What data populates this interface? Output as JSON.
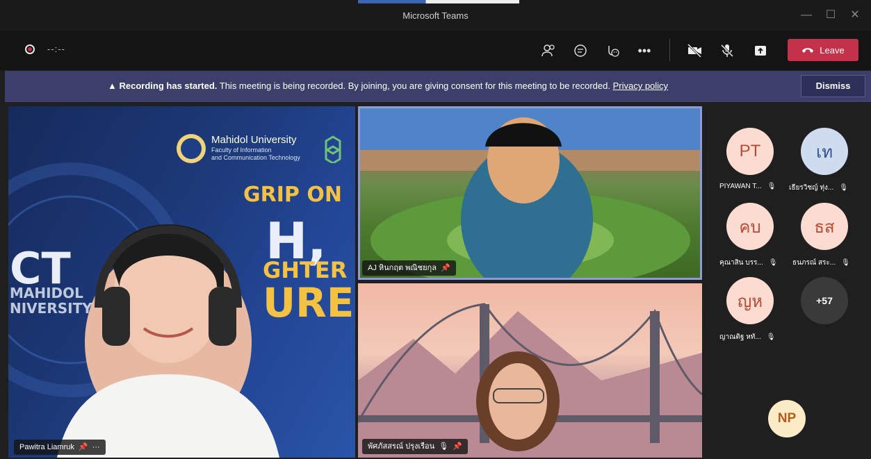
{
  "window": {
    "title": "Microsoft Teams"
  },
  "toolbar": {
    "timer": "--:--",
    "leave_label": "Leave",
    "icons": [
      "participants-icon",
      "chat-icon",
      "reactions-icon",
      "more-icon",
      "camera-off-icon",
      "mic-off-icon",
      "share-icon",
      "phone-hangup-icon"
    ]
  },
  "banner": {
    "bold": "Recording has started.",
    "text": "This meeting is being recorded. By joining, you are giving consent for this meeting to be recorded.",
    "link": "Privacy policy",
    "dismiss": "Dismiss"
  },
  "stage": {
    "main": {
      "name": "Pawitra Liamruk",
      "more": "···",
      "background": {
        "university": "Mahidol University",
        "faculty_line1": "Faculty of Information",
        "faculty_line2": "and Communication Technology",
        "ict": "CT",
        "mahidol": "MAHIDOL",
        "univ": "NIVERSITY",
        "headline1": "GRIP ON",
        "headline2": "H,",
        "headline3": "GHTER",
        "headline4": "URE"
      }
    },
    "top_right": {
      "name": "AJ หินกฤต พณิชยกุล"
    },
    "bottom_right": {
      "name": "พัศภัสสรณ์ ปรุงเรือน"
    }
  },
  "roster": [
    {
      "initials": "PT",
      "name": "PIYAWAN T...",
      "color": "pink"
    },
    {
      "initials": "เท",
      "name": "เธียรวิชญ์ ทุ่ง...",
      "color": "blue"
    },
    {
      "initials": "คบ",
      "name": "คุณาสิน บรร...",
      "color": "pink"
    },
    {
      "initials": "ธส",
      "name": "ธนภรณ์ สระ...",
      "color": "pink"
    },
    {
      "initials": "ญห",
      "name": "ญาณติฐ หทั...",
      "color": "pink"
    },
    {
      "initials": "+57",
      "name": "",
      "color": "dark"
    }
  ],
  "bottom_avatar": {
    "initials": "NP"
  },
  "colors": {
    "leave": "#c4314b",
    "banner": "#3b3f69",
    "tile_border": "#8e9bd6"
  }
}
